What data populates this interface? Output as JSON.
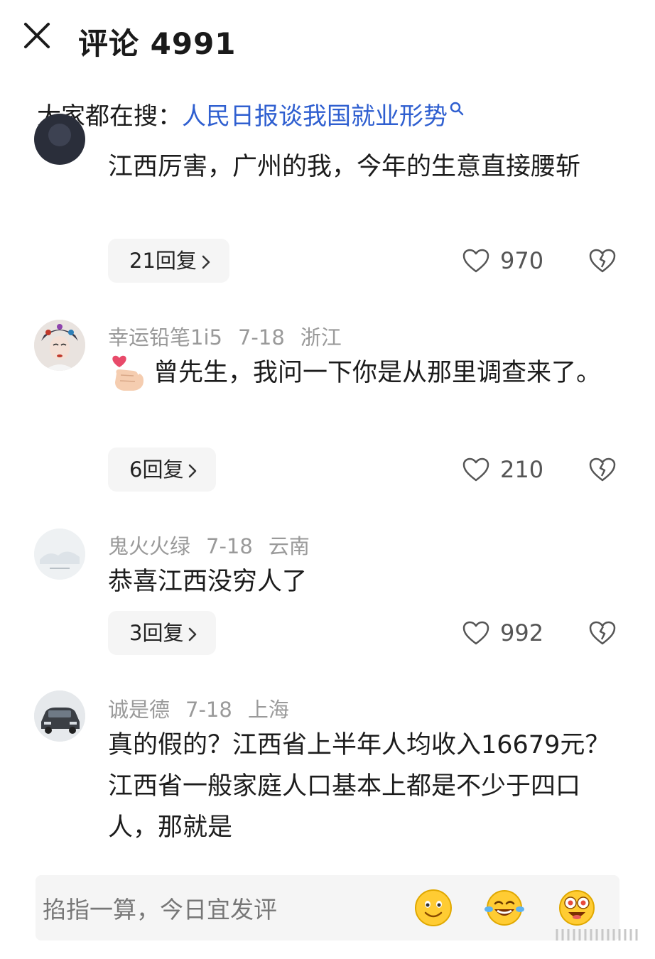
{
  "header": {
    "title": "评论 4991",
    "close_icon": "close-icon"
  },
  "hot_search": {
    "prefix": "大家都在搜：",
    "topic": "人民日报谈我国就业形势",
    "icon": "search-icon"
  },
  "comments": [
    {
      "text": "江西厉害，广州的我，今年的生意直接腰斩",
      "replies": "21回复",
      "likes": "970"
    },
    {
      "user": "幸运铅笔1i5",
      "date": "7-18",
      "location": "浙江",
      "text": "曾先生，我问一下你是从那里调查来了。",
      "replies": "6回复",
      "likes": "210"
    },
    {
      "user": "鬼火火绿",
      "date": "7-18",
      "location": "云南",
      "text": "恭喜江西没穷人了",
      "replies": "3回复",
      "likes": "992"
    },
    {
      "user": "诚是德",
      "date": "7-18",
      "location": "上海",
      "text": "真的假的？江西省上半年人均收入16679元？江西省一般家庭人口基本上都是不少于四口人，那就是"
    }
  ],
  "input": {
    "placeholder": "掐指一算，今日宜发评"
  },
  "colors": {
    "link": "#2f5fd0",
    "meta": "#9a9a9a",
    "reply_bg": "#f5f5f5"
  }
}
